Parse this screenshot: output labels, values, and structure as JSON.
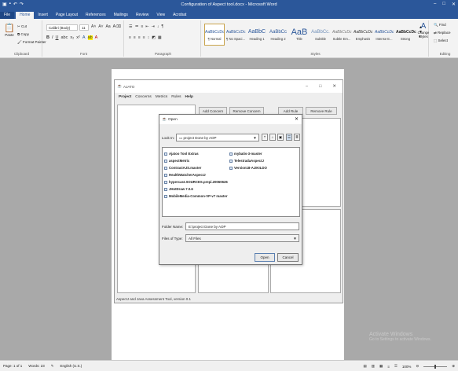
{
  "word": {
    "title": "Configuration of Aspect tool.docx - Microsoft Word",
    "tabs": [
      "File",
      "Home",
      "Insert",
      "Page Layout",
      "References",
      "Mailings",
      "Review",
      "View",
      "Acrobat"
    ],
    "clipboard": {
      "paste": "Paste",
      "cut": "Cut",
      "copy": "Copy",
      "format_painter": "Format Painter",
      "label": "Clipboard"
    },
    "font": {
      "name": "Calibri (Body)",
      "size": "11",
      "label": "Font"
    },
    "paragraph_label": "Paragraph",
    "styles": [
      {
        "preview": "AaBbCcDc",
        "name": "¶ Normal"
      },
      {
        "preview": "AaBbCcDc",
        "name": "¶ No Spaci..."
      },
      {
        "preview": "AaBbC",
        "name": "Heading 1"
      },
      {
        "preview": "AaBbCc",
        "name": "Heading 2"
      },
      {
        "preview": "AaB",
        "name": "Title"
      },
      {
        "preview": "AaBbCc.",
        "name": "Subtitle"
      },
      {
        "preview": "AaBbCcDc",
        "name": "Subtle Em..."
      },
      {
        "preview": "AaBbCcDc",
        "name": "Emphasis"
      },
      {
        "preview": "AaBbCcDc",
        "name": "Intense E..."
      },
      {
        "preview": "AaBbCcDc",
        "name": "Strong"
      },
      {
        "preview": "AaBbCcDc",
        "name": "Quote"
      }
    ],
    "styles_label": "Styles",
    "change_styles": "Change Styles",
    "editing": {
      "find": "Find",
      "replace": "Replace",
      "select": "Select",
      "label": "Editing"
    },
    "status": {
      "page": "Page: 1 of 1",
      "words": "Words: 23",
      "language": "English (U.S.)",
      "zoom": "100%"
    }
  },
  "app": {
    "title": "AJATO",
    "menu": [
      "Project",
      "Concerns",
      "Metrics",
      "Rules",
      "Help"
    ],
    "buttons": {
      "add_concern": "Add Concern",
      "remove_concern": "Remove Concern",
      "add_rule": "Add Rule",
      "remove_rule": "Remove Rule"
    },
    "status": "AspectJ and Java Assessment Tool, version 0.1"
  },
  "dialog": {
    "title": "Open",
    "look_in_label": "Look In:",
    "look_in_value": "project Done by AOP",
    "files_col1": [
      "Ajatoo Tool Extras",
      "aspectMetric",
      "ContractAJS.master",
      "HealthWatcherAspectJ",
      "hypercast.SOURCES.prepi.20060626",
      "JHotDraw 7.0.6",
      "MobileMedia-Common-VP-v7 master"
    ],
    "files_col2": [
      "mybatis-3-master",
      "TelestradaAspectJ",
      "Version18-AJIKILDO"
    ],
    "folder_name_label": "Folder Name:",
    "folder_name_value": "E:\\project Done by AOP",
    "files_of_type_label": "Files of Type:",
    "files_of_type_value": "All Files",
    "open_button": "Open",
    "cancel_button": "Cancel"
  },
  "watermark": {
    "line1": "Activate Windows",
    "line2": "Go to Settings to activate Windows."
  }
}
